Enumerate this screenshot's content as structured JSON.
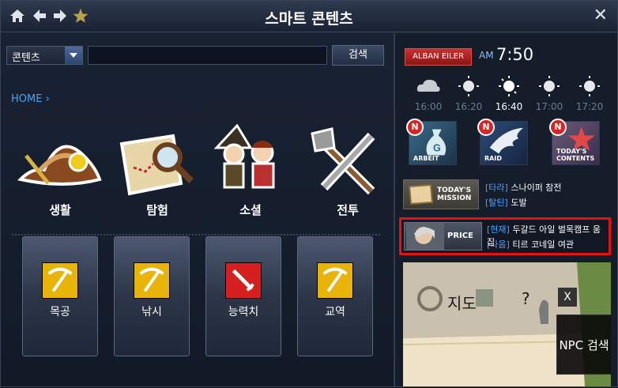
{
  "title": "스마트 콘텐츠",
  "search": {
    "category": "콘텐츠",
    "query": "",
    "button": "검색"
  },
  "breadcrumb": "HOME",
  "categories": [
    {
      "label": "생활",
      "icon": "harvest-hat-icon"
    },
    {
      "label": "탐험",
      "icon": "map-magnifier-icon"
    },
    {
      "label": "소셜",
      "icon": "characters-icon"
    },
    {
      "label": "전투",
      "icon": "crossed-weapons-icon"
    }
  ],
  "skills": [
    {
      "label": "목공",
      "icon": "pickaxe-icon",
      "color": "#e8b40a"
    },
    {
      "label": "낚시",
      "icon": "pickaxe-icon",
      "color": "#e8b40a"
    },
    {
      "label": "능력치",
      "icon": "sword-icon",
      "color": "#d62020"
    },
    {
      "label": "교역",
      "icon": "pickaxe-icon",
      "color": "#e8b40a"
    }
  ],
  "server": "ALBAN EILER",
  "time": {
    "ampm": "AM",
    "clock": "7:50"
  },
  "weather": [
    {
      "time": "16:00",
      "icon": "cloud-icon"
    },
    {
      "time": "16:20",
      "icon": "sun-icon"
    },
    {
      "time": "16:40",
      "icon": "sun-icon",
      "current": true
    },
    {
      "time": "17:00",
      "icon": "sun-icon"
    },
    {
      "time": "17:20",
      "icon": "sun-icon"
    }
  ],
  "tiles": [
    {
      "label": "ARBEIT",
      "badge": "N"
    },
    {
      "label": "RAID",
      "badge": "N"
    },
    {
      "label": "TODAY'S CONTENTS",
      "badge": "N"
    }
  ],
  "mission": {
    "button": "TODAY'S MISSION",
    "lines": [
      {
        "tag": "[타라]",
        "text": "스나이퍼 참전"
      },
      {
        "tag": "[탈틴]",
        "text": "도발"
      }
    ]
  },
  "price": {
    "button": "PRICE",
    "lines": [
      {
        "tag": "[현재]",
        "text": "두갈드 아일 벌목캠프 움집"
      },
      {
        "tag": "[다음]",
        "text": "티르 코네일 여관"
      }
    ]
  },
  "map": {
    "label": "지도",
    "question": "?",
    "close": "X",
    "npc_button": "NPC 검색"
  },
  "colors": {
    "accent": "#4ba3ff",
    "highlight": "#e61010",
    "server": "#b82222"
  }
}
